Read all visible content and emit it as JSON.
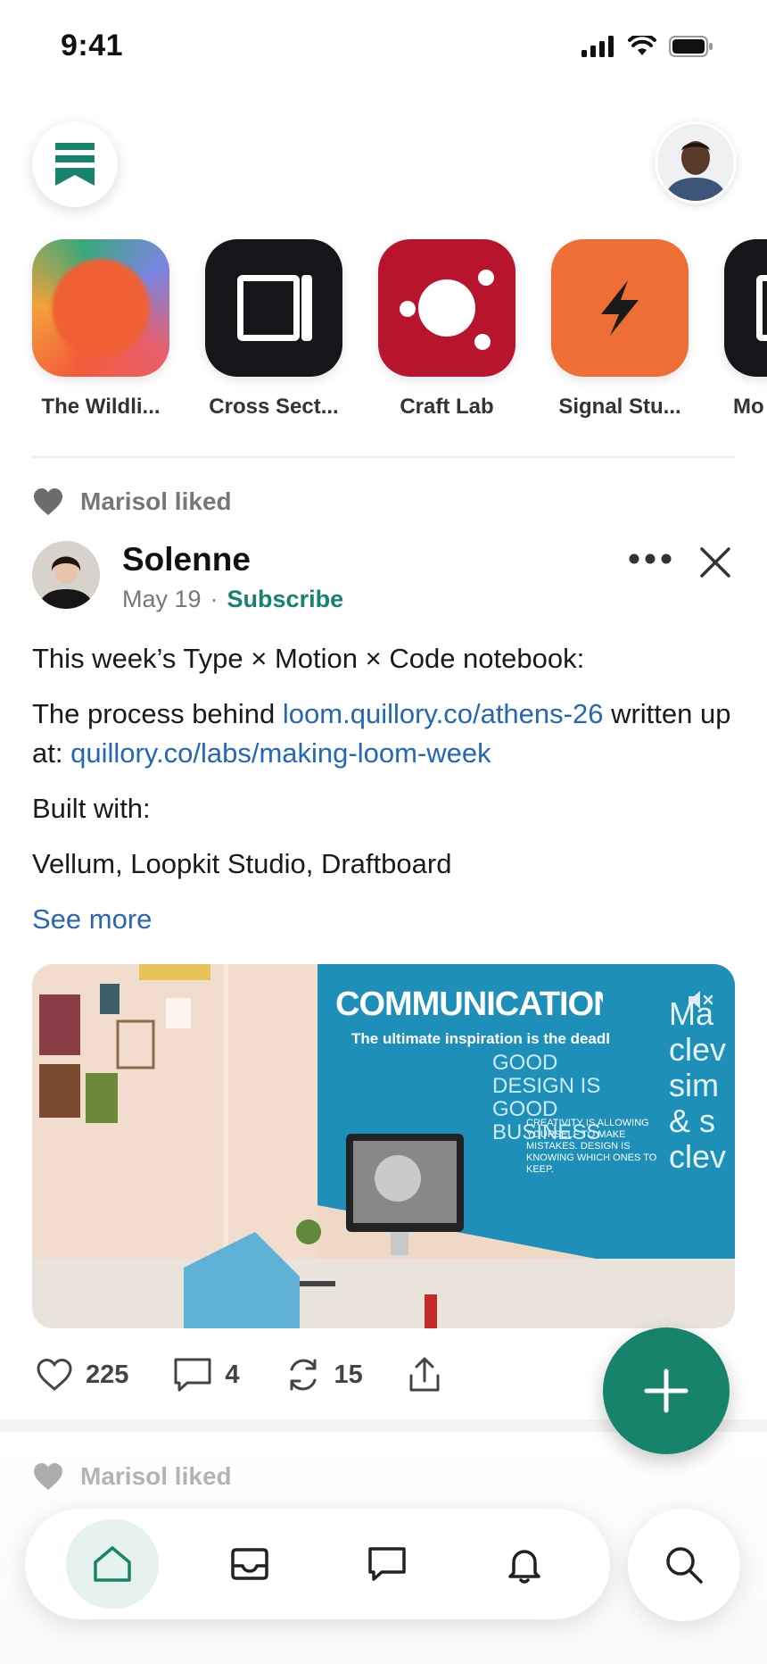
{
  "status_bar": {
    "time": "9:41"
  },
  "colors": {
    "accent": "#17836a",
    "link": "#2367b6",
    "muted": "#777777"
  },
  "publications": [
    {
      "label": "The Wildli...",
      "icon": "gradient-circle-icon"
    },
    {
      "label": "Cross Sect...",
      "icon": "square-frame-icon"
    },
    {
      "label": "Craft Lab",
      "icon": "orbit-dots-icon"
    },
    {
      "label": "Signal Stu...",
      "icon": "lightning-icon"
    },
    {
      "label": "Mo",
      "icon": "partial-icon"
    }
  ],
  "post": {
    "liked_by": "Marisol liked",
    "author": "Solenne",
    "date": "May 19",
    "separator": "·",
    "subscribe": "Subscribe",
    "line1": "This week’s Type × Motion × Code notebook:",
    "line2_prefix": "The process behind ",
    "link1": "loom.quillory.co/athens-26",
    "line2_mid": " written up at: ",
    "link2": "quillory.co/labs/making-loom-week",
    "line3": "Built with:",
    "line4": "Vellum, Loopkit Studio, Draftboard",
    "see_more": "See more",
    "media": {
      "wall_heading": "COMMUNICATION",
      "wall_sub": "The ultimate inspiration is the deadline",
      "wall_side": "GOOD DESIGN IS GOOD BUSINESS",
      "wall_small": "CREATIVITY IS ALLOWING YOURSELF TO MAKE MISTAKES. DESIGN IS KNOWING WHICH ONES TO KEEP.",
      "wall_right": "Ma clev sim & s clev"
    },
    "likes": "225",
    "comments": "4",
    "restacks": "15"
  },
  "next_post": {
    "liked_by": "Marisol liked"
  },
  "tabs": [
    {
      "name": "home",
      "active": true
    },
    {
      "name": "inbox",
      "active": false
    },
    {
      "name": "chat",
      "active": false
    },
    {
      "name": "notifications",
      "active": false
    }
  ]
}
